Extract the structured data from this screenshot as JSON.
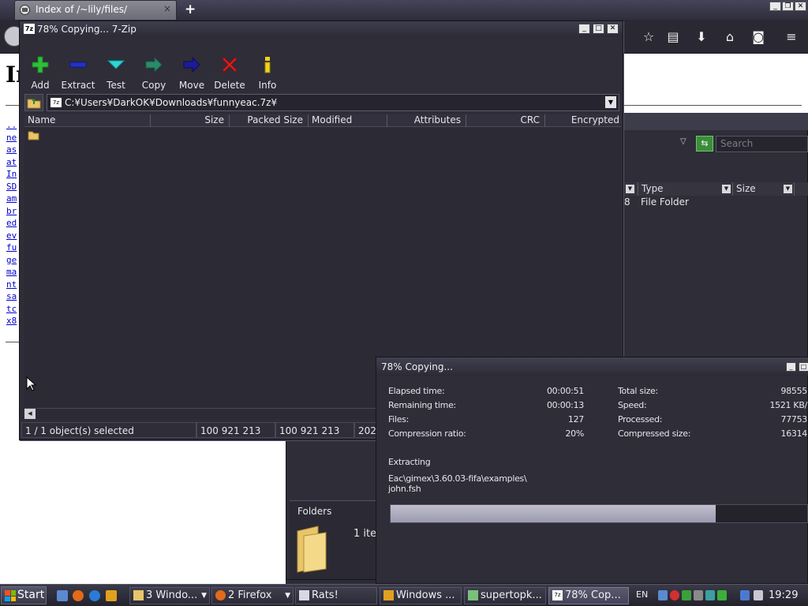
{
  "firefox": {
    "tab_title": "Index of /~lily/files/",
    "tab_close": "×",
    "new_tab": "+",
    "heading": "In",
    "links": [
      "..",
      "ne",
      "as",
      "at",
      "In",
      "SD",
      "am",
      "br",
      "ed",
      "ev",
      "fu",
      "ge",
      "ma",
      "nt",
      "sa",
      "tc",
      "x8"
    ],
    "window_controls": [
      "_",
      "❐",
      "✕"
    ]
  },
  "explorer": {
    "search_placeholder": "Search",
    "columns": {
      "type": "Type",
      "size": "Size"
    },
    "row": {
      "partial": "8",
      "type": "File Folder"
    },
    "folders_label": "Folders",
    "items_partial": "1 ite"
  },
  "sevenzip": {
    "title": "78% Copying... 7-Zip",
    "window_controls": [
      "_",
      "□",
      "✕"
    ],
    "toolbar": [
      {
        "label": "Add",
        "icon": "add-icon"
      },
      {
        "label": "Extract",
        "icon": "extract-icon"
      },
      {
        "label": "Test",
        "icon": "test-icon"
      },
      {
        "label": "Copy",
        "icon": "copy-icon"
      },
      {
        "label": "Move",
        "icon": "move-icon"
      },
      {
        "label": "Delete",
        "icon": "delete-icon"
      },
      {
        "label": "Info",
        "icon": "info-icon"
      }
    ],
    "path": "C:¥Users¥DarkOK¥Downloads¥funnyeac.7z¥",
    "columns": [
      "Name",
      "Size",
      "Packed Size",
      "Modified",
      "Attributes",
      "CRC",
      "Encrypted"
    ],
    "status": {
      "selection": "1 / 1 object(s) selected",
      "size": "100 921 213",
      "packed": "100 921 213",
      "modified": "202"
    }
  },
  "progress": {
    "title": "78% Copying...",
    "window_controls": [
      "_",
      "□"
    ],
    "left_labels": [
      "Elapsed time:",
      "Remaining time:",
      "Files:",
      "Compression ratio:"
    ],
    "left_values": [
      "00:00:51",
      "00:00:13",
      "127",
      "20%"
    ],
    "right_labels": [
      "Total size:",
      "Speed:",
      "Processed:",
      "Compressed size:"
    ],
    "right_values": [
      "98555",
      "1521 KB/",
      "77753",
      "16314"
    ],
    "operation": "Extracting",
    "current_path": "Eac\\gimex\\3.60.03-fifa\\examples\\",
    "current_file": "john.fsh",
    "percent": 78
  },
  "taskbar": {
    "start": "Start",
    "buttons": [
      {
        "label": "3 Windo...",
        "icon": "folder-group-icon"
      },
      {
        "label": "2 Firefox",
        "icon": "firefox-icon"
      },
      {
        "label": "Rats!",
        "icon": "app-icon"
      },
      {
        "label": "Windows ...",
        "icon": "media-icon"
      },
      {
        "label": "supertopk...",
        "icon": "app-icon"
      },
      {
        "label": "78% Cop...",
        "icon": "sevenzip-icon"
      }
    ],
    "language": "EN",
    "clock": "19:29"
  },
  "colors": {
    "dark_bg": "#2e2d38",
    "progress_fill": "#a9a9bc",
    "link_blue": "#0000cc"
  }
}
